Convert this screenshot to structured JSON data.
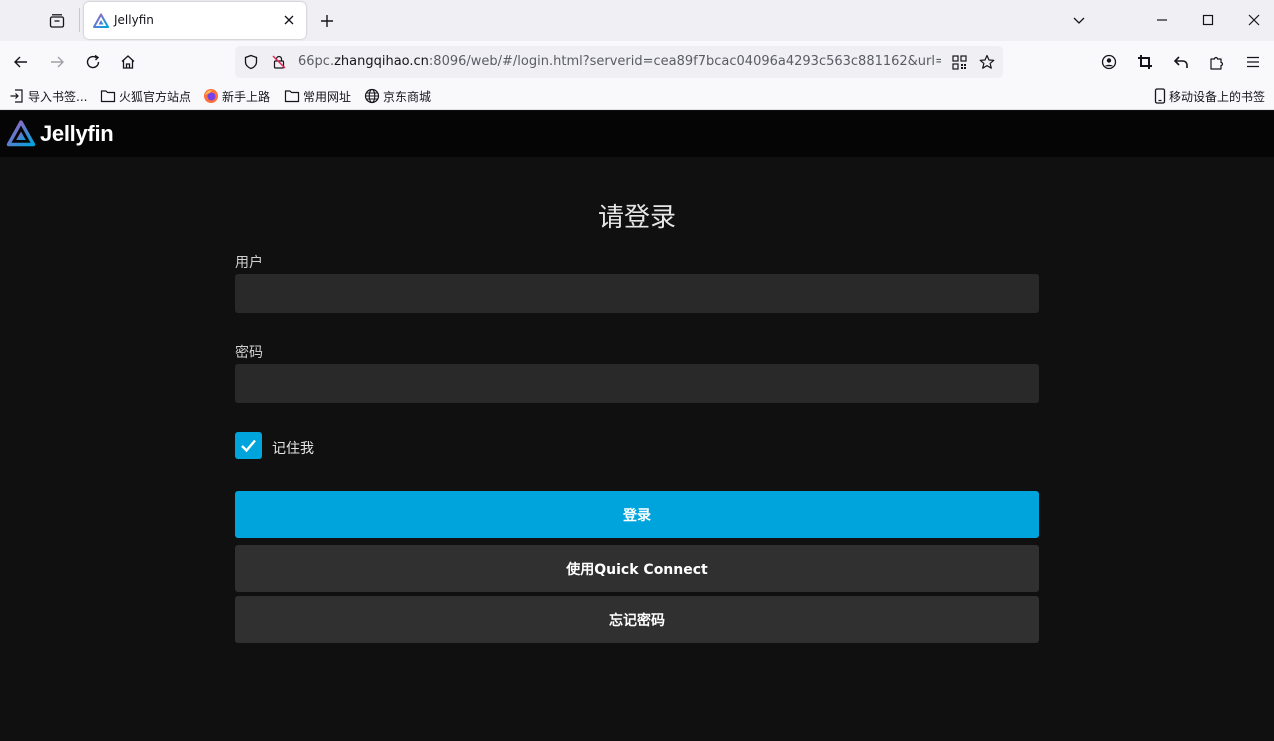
{
  "browser": {
    "tab_title": "Jellyfin",
    "url_prefix": "66pc.",
    "url_host": "zhangqihao.cn",
    "url_rest": ":8096/web/#/login.html?serverid=cea89f7bcac04096a4293c563c881162&url=",
    "bookmarks": [
      {
        "label": "导入书签...",
        "icon": "import-icon"
      },
      {
        "label": "火狐官方站点",
        "icon": "folder-icon"
      },
      {
        "label": "新手上路",
        "icon": "firefox-icon"
      },
      {
        "label": "常用网址",
        "icon": "folder-icon"
      },
      {
        "label": "京东商城",
        "icon": "globe-icon"
      }
    ],
    "mobile_bookmarks": "移动设备上的书签"
  },
  "app": {
    "logo_text": "Jellyfin",
    "title": "请登录",
    "user_label": "用户",
    "user_value": "",
    "password_label": "密码",
    "password_value": "",
    "remember_label": "记住我",
    "remember_checked": true,
    "login_button": "登录",
    "quick_connect_button": "使用Quick Connect",
    "forgot_button": "忘记密码"
  },
  "colors": {
    "accent": "#00a4dc",
    "background": "#101010",
    "input": "#292929",
    "secondary_button": "#303030"
  }
}
